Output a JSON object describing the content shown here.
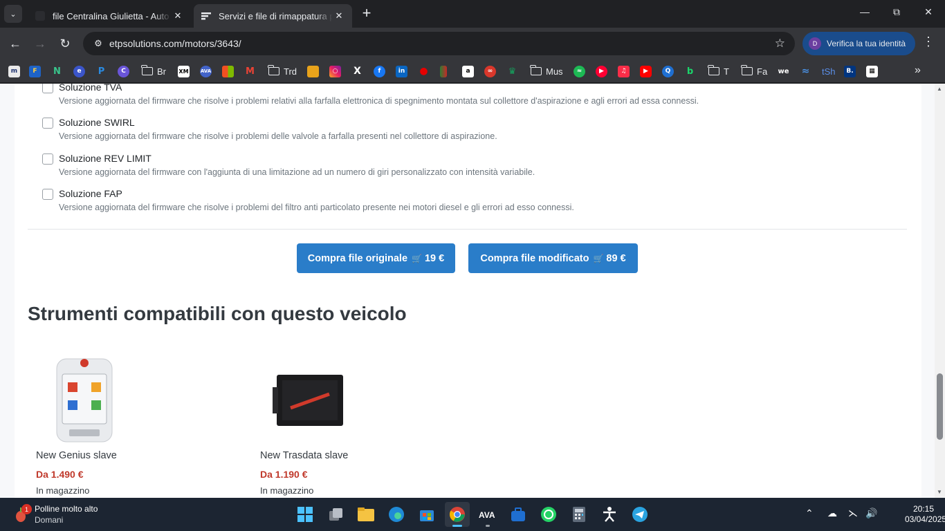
{
  "browser": {
    "tabs": [
      {
        "title": "file Centralina Giulietta - Auto d",
        "active": false
      },
      {
        "title": "Servizi e file di rimappatura per",
        "active": true
      }
    ],
    "url": "etpsolutions.com/motors/3643/",
    "profile_label": "Verifica la tua identità",
    "profile_initial": "D",
    "bookmarks": [
      "Br",
      "Trd",
      "Mus",
      "T",
      "Fa",
      "tSh"
    ]
  },
  "page": {
    "options": [
      {
        "label": "Soluzione TVA",
        "description": "Versione aggiornata del firmware che risolve i problemi relativi alla farfalla elettronica di spegnimento montata sul collettore d'aspirazione e agli errori ad essa connessi."
      },
      {
        "label": "Soluzione SWIRL",
        "description": "Versione aggiornata del firmware che risolve i problemi delle valvole a farfalla presenti nel collettore di aspirazione."
      },
      {
        "label": "Soluzione REV LIMIT",
        "description": "Versione aggiornata del firmware con l'aggiunta di una limitazione ad un numero di giri personalizzato con intensità variabile."
      },
      {
        "label": "Soluzione FAP",
        "description": "Versione aggiornata del firmware che risolve i problemi del filtro anti particolato presente nei motori diesel e gli errori ad esso connessi."
      }
    ],
    "buy_original": {
      "label": "Compra file originale",
      "price": "19 €"
    },
    "buy_modified": {
      "label": "Compra file modificato",
      "price": "89 €"
    },
    "section_title": "Strumenti compatibili con questo veicolo",
    "products": [
      {
        "name": "New Genius slave",
        "price": "Da 1.490 €",
        "stock": "In magazzino"
      },
      {
        "name": "New Trasdata slave",
        "price": "Da 1.190 €",
        "stock": "In magazzino"
      }
    ],
    "accent_color": "#2a7dc9",
    "price_color": "#c0392b"
  },
  "taskbar": {
    "weather_title": "Polline molto alto",
    "weather_subtitle": "Domani",
    "weather_badge": "1",
    "time": "20:15",
    "date": "03/04/2025"
  }
}
